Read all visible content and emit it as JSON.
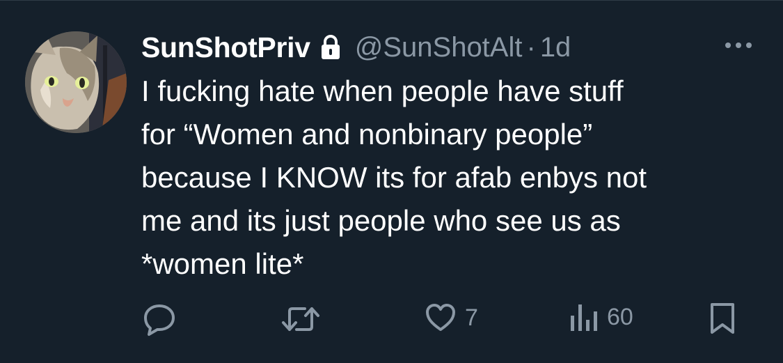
{
  "tweet": {
    "display_name": "SunShotPriv",
    "handle": "@SunShotAlt",
    "separator": "·",
    "time": "1d",
    "protected": true,
    "avatar_icon": "cat-photo-avatar",
    "text": "I fucking hate when people have stuff\nfor “Women and nonbinary people”\nbecause I KNOW its for afab enbys not\nme and its just people who see us as\n*women lite*"
  },
  "actions": {
    "reply_icon": "reply-icon",
    "retweet_icon": "retweet-icon",
    "like_icon": "heart-icon",
    "like_count": "7",
    "views_icon": "views-icon",
    "views_count": "60",
    "bookmark_icon": "bookmark-icon"
  },
  "colors": {
    "background": "#15202b",
    "text": "#ffffff",
    "secondary": "#8b98a5"
  }
}
